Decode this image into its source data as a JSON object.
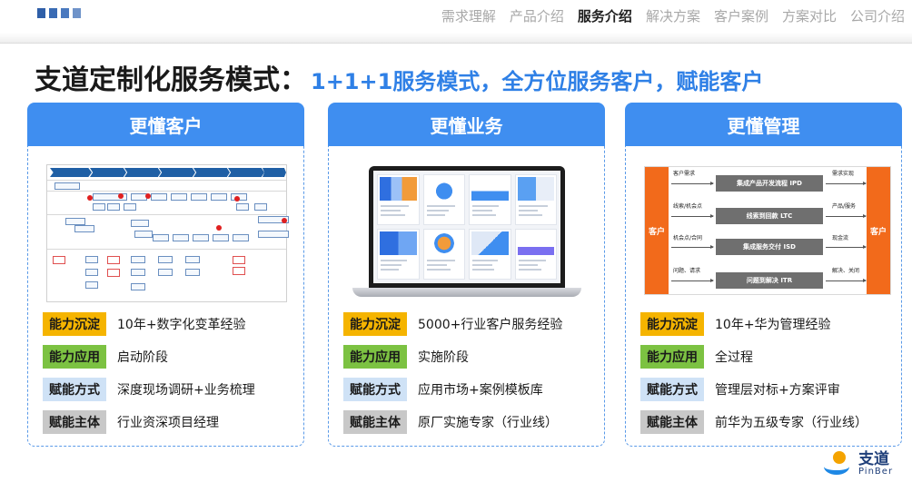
{
  "nav": {
    "items": [
      "需求理解",
      "产品介绍",
      "服务介绍",
      "解决方案",
      "客户案例",
      "方案对比",
      "公司介绍"
    ],
    "active": "服务介绍"
  },
  "title": {
    "main": "支道定制化服务模式：",
    "sub": "1+1+1服务模式，全方位服务客户，赋能客户"
  },
  "cards": [
    {
      "header": "更懂客户",
      "rows": [
        {
          "badge": "能力沉淀",
          "value": "10年+数字化变革经验",
          "color": "yellow"
        },
        {
          "badge": "能力应用",
          "value": "启动阶段",
          "color": "green"
        },
        {
          "badge": "赋能方式",
          "value": "深度现场调研+业务梳理",
          "color": "lightblue"
        },
        {
          "badge": "赋能主体",
          "value": "行业资深项目经理",
          "color": "gray"
        }
      ]
    },
    {
      "header": "更懂业务",
      "rows": [
        {
          "badge": "能力沉淀",
          "value": "5000+行业客户服务经验",
          "color": "yellow"
        },
        {
          "badge": "能力应用",
          "value": "实施阶段",
          "color": "green"
        },
        {
          "badge": "赋能方式",
          "value": "应用市场+案例模板库",
          "color": "lightblue"
        },
        {
          "badge": "赋能主体",
          "value": "原厂实施专家（行业线）",
          "color": "gray"
        }
      ]
    },
    {
      "header": "更懂管理",
      "rows": [
        {
          "badge": "能力沉淀",
          "value": "10年+华为管理经验",
          "color": "yellow"
        },
        {
          "badge": "能力应用",
          "value": "全过程",
          "color": "green"
        },
        {
          "badge": "赋能方式",
          "value": "管理层对标+方案评审",
          "color": "lightblue"
        },
        {
          "badge": "赋能主体",
          "value": "前华为五级专家（行业线）",
          "color": "gray"
        }
      ]
    }
  ],
  "mgmt": {
    "left": "客户",
    "right": "客户",
    "bars": [
      "集成产品开发流程 IPD",
      "线索到回款 LTC",
      "集成服务交付 ISD",
      "问题到解决 ITR"
    ],
    "inputs": [
      "客户需求",
      "线索/机会点",
      "机会点/合同",
      "问题、请求"
    ],
    "outputs": [
      "需求实现",
      "产品/服务",
      "现金流",
      "解决、关闭"
    ]
  },
  "brand": {
    "cn": "支道",
    "en": "PinBer"
  },
  "colors": {
    "accent": "#3f8ef0",
    "title_blue": "#2f80e6",
    "orange": "#f26a1b"
  }
}
